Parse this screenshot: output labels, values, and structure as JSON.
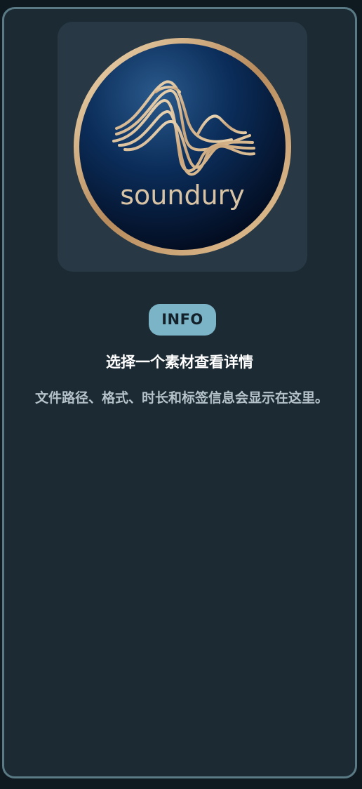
{
  "logo": {
    "icon": "soundury-logo",
    "wordmark": "soundury",
    "colors": {
      "gold": "#d9b98a",
      "navy": "#0a2a52",
      "ring": "#b89060"
    }
  },
  "info_panel": {
    "badge": "INFO",
    "title": "选择一个素材查看详情",
    "description": "文件路径、格式、时长和标签信息会显示在这里。"
  },
  "colors": {
    "badge_bg": "#7cb4c7",
    "panel_bg": "#1c2a33",
    "panel_border": "#5a7a86"
  }
}
